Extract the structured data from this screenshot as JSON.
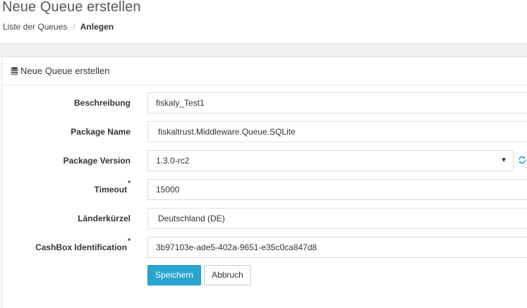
{
  "page": {
    "title": "Neue Queue erstellen"
  },
  "breadcrumb": {
    "link": "Liste der Queues",
    "separator": "/",
    "current": "Anlegen"
  },
  "panel": {
    "heading": "Neue Queue erstellen",
    "icon": "database-icon"
  },
  "form": {
    "description": {
      "label": "Beschreibung",
      "value": "fiskaly_Test1"
    },
    "package_name": {
      "label": "Package Name",
      "value": "fiskaltrust.Middleware.Queue.SQLite"
    },
    "package_version": {
      "label": "Package Version",
      "value": "1.3.0-rc2",
      "refresh_icon": "refresh-icon"
    },
    "timeout": {
      "label": "Timeout",
      "required_mark": "*",
      "value": "15000"
    },
    "country_code": {
      "label": "Länderkürzel",
      "value": "Deutschland (DE)"
    },
    "cashbox_id": {
      "label": "CashBox Identification",
      "required_mark": "*",
      "value": "3b97103e-ade5-402a-9651-e35c0ca847d8"
    }
  },
  "buttons": {
    "save": "Speichern",
    "cancel": "Abbruch"
  },
  "colors": {
    "primary": "#2aa5cf",
    "refresh_icon": "#2aa5cf"
  }
}
